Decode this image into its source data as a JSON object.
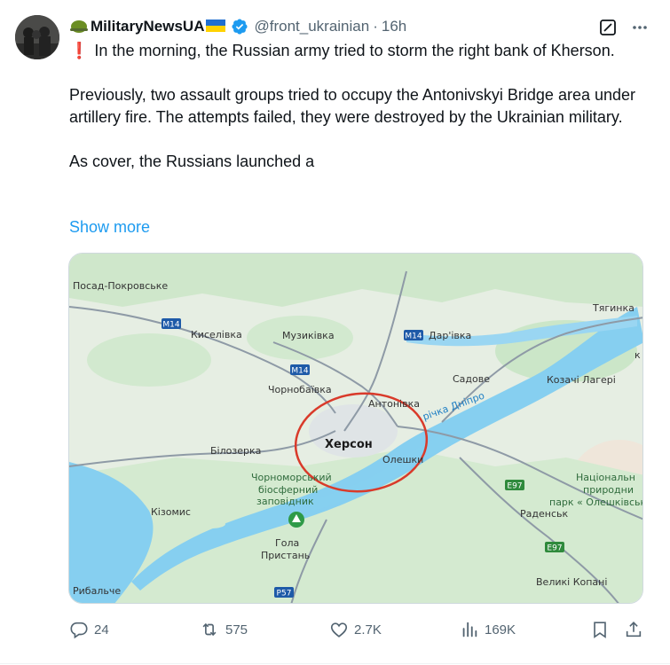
{
  "author": {
    "display_name": "MilitaryNewsUA",
    "handle": "@front_ukrainian",
    "separator": "·",
    "time": "16h"
  },
  "icons": {
    "grok": "grok-icon",
    "more": "more-icon",
    "verified": "verified-badge-icon",
    "soldier_emoji": "military-helmet-emoji",
    "flag_emoji": "ukraine-flag-emoji",
    "exclamation": "red-exclamation-icon"
  },
  "tweet": {
    "exclamation": "❗",
    "line1": "In the morning, the Russian army tried to storm the right bank of Kherson.",
    "paragraph2": "Previously, two assault groups tried to occupy the Antonivskyi Bridge area under artillery fire. The attempts failed, they were destroyed by the Ukrainian military.",
    "paragraph3": "As cover, the Russians launched a",
    "show_more": "Show more"
  },
  "map": {
    "labels": {
      "posad": "Посад-Покровське",
      "tyahynka": "Тягинка",
      "kyselivka": "Киселівка",
      "muzykivka": "Музиківка",
      "darivka": "Дар'івка",
      "chornobaivka": "Чорнобаївка",
      "sadove": "Садове",
      "kozachi": "Козачі Лагері",
      "antonivka": "Антонівка",
      "river": "річка Дніпро",
      "kherson": "Херсон",
      "bilozerka": "Білозерка",
      "oleshky": "Олешки",
      "reserve1": "Чорноморський",
      "reserve2": "біосферний",
      "reserve3": "заповідник",
      "park1": "Національн",
      "park2": "природни",
      "park3": "парк « Олешківськ",
      "kizomys": "Кізомис",
      "radensk": "Раденськ",
      "hola1": "Гола",
      "hola2": "Пристань",
      "rybalche": "Рибальче",
      "velyki": "Великі Копані",
      "m14a": "M14",
      "m14b": "M14",
      "m14c": "M14",
      "e97a": "E97",
      "e97b": "E97",
      "p57": "P57",
      "arrow": "к"
    },
    "colors": {
      "land": "#e8efe5",
      "green": "#c9e8c8",
      "water": "#86cff0",
      "circle": "#d93a2a",
      "road": "#8e9aa6"
    }
  },
  "actions": {
    "replies": "24",
    "reposts": "575",
    "likes": "2.7K",
    "views": "169K"
  }
}
